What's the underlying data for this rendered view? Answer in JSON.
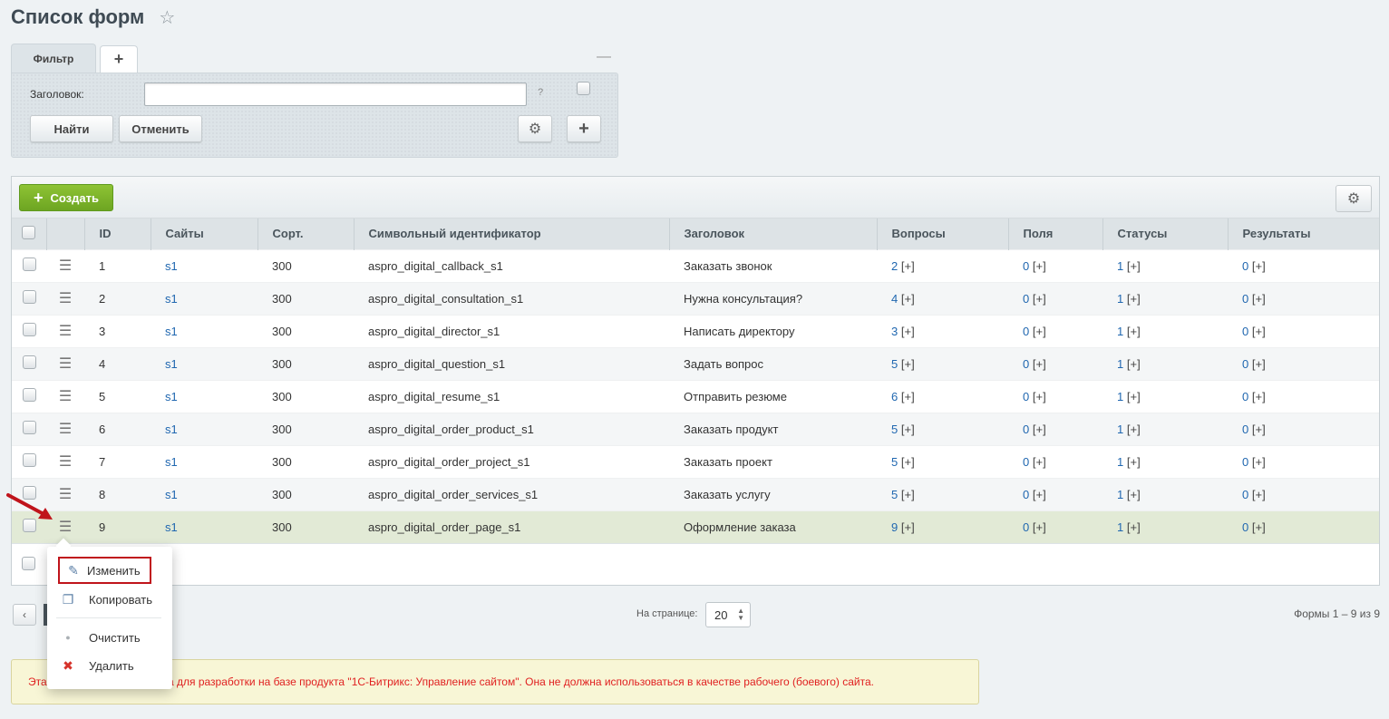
{
  "page": {
    "title": "Список форм",
    "star_icon": "star-icon"
  },
  "filter": {
    "tab_label": "Фильтр",
    "add_tab_label": "+",
    "collapse_label": "—",
    "field_label": "Заголовок:",
    "field_value": "",
    "help_label": "?",
    "find_label": "Найти",
    "cancel_label": "Отменить",
    "gear_icon": "gear-icon",
    "add_label": "+"
  },
  "grid": {
    "create_label": "Создать",
    "columns": [
      "ID",
      "Сайты",
      "Сорт.",
      "Символьный идентификатор",
      "Заголовок",
      "Вопросы",
      "Поля",
      "Статусы",
      "Результаты"
    ],
    "rows": [
      {
        "id": "1",
        "site": "s1",
        "sort": "300",
        "sid": "aspro_digital_callback_s1",
        "title": "Заказать звонок",
        "questions": "2",
        "fields": "0",
        "statuses": "1",
        "results": "0"
      },
      {
        "id": "2",
        "site": "s1",
        "sort": "300",
        "sid": "aspro_digital_consultation_s1",
        "title": "Нужна консультация?",
        "questions": "4",
        "fields": "0",
        "statuses": "1",
        "results": "0"
      },
      {
        "id": "3",
        "site": "s1",
        "sort": "300",
        "sid": "aspro_digital_director_s1",
        "title": "Написать директору",
        "questions": "3",
        "fields": "0",
        "statuses": "1",
        "results": "0"
      },
      {
        "id": "4",
        "site": "s1",
        "sort": "300",
        "sid": "aspro_digital_question_s1",
        "title": "Задать вопрос",
        "questions": "5",
        "fields": "0",
        "statuses": "1",
        "results": "0"
      },
      {
        "id": "5",
        "site": "s1",
        "sort": "300",
        "sid": "aspro_digital_resume_s1",
        "title": "Отправить резюме",
        "questions": "6",
        "fields": "0",
        "statuses": "1",
        "results": "0"
      },
      {
        "id": "6",
        "site": "s1",
        "sort": "300",
        "sid": "aspro_digital_order_product_s1",
        "title": "Заказать продукт",
        "questions": "5",
        "fields": "0",
        "statuses": "1",
        "results": "0"
      },
      {
        "id": "7",
        "site": "s1",
        "sort": "300",
        "sid": "aspro_digital_order_project_s1",
        "title": "Заказать проект",
        "questions": "5",
        "fields": "0",
        "statuses": "1",
        "results": "0"
      },
      {
        "id": "8",
        "site": "s1",
        "sort": "300",
        "sid": "aspro_digital_order_services_s1",
        "title": "Заказать услугу",
        "questions": "5",
        "fields": "0",
        "statuses": "1",
        "results": "0"
      },
      {
        "id": "9",
        "site": "s1",
        "sort": "300",
        "sid": "aspro_digital_order_page_s1",
        "title": "Оформление заказа",
        "questions": "9",
        "fields": "0",
        "statuses": "1",
        "results": "0"
      }
    ],
    "add_link": "[+]",
    "selected_row": 8
  },
  "context_menu": {
    "edit": "Изменить",
    "copy": "Копировать",
    "clear": "Очистить",
    "delete": "Удалить"
  },
  "pagination": {
    "prev": "‹",
    "per_page_label": "На странице:",
    "per_page_value": "20",
    "total": "Формы 1 – 9 из 9"
  },
  "warning": {
    "text_left": "Эта",
    "text_right": "ена для разработки на базе продукта \"1С-Битрикс: Управление сайтом\". Она не должна использоваться в качестве рабочего (боевого) сайта."
  },
  "colors": {
    "accent_green": "#7ab52c",
    "link_blue": "#2067b0",
    "warning_red": "#e02020",
    "highlight_red": "#c0141b"
  }
}
